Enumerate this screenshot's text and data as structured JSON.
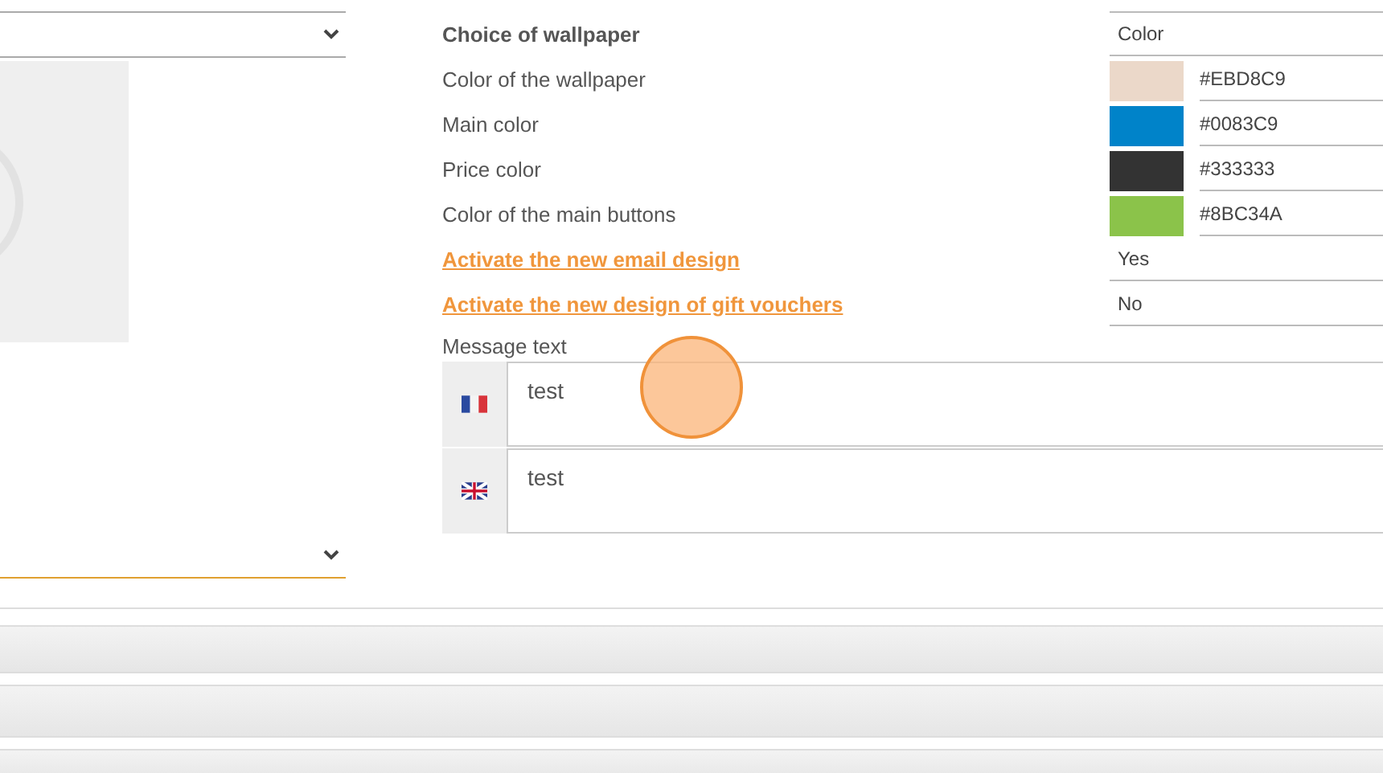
{
  "left_panel": {
    "selects": [
      {
        "focused": false
      },
      {
        "focused": true
      }
    ]
  },
  "settings": [
    {
      "label": "Choice of wallpaper",
      "kind": "heading",
      "value": "Color"
    },
    {
      "label": "Color of the wallpaper",
      "kind": "color",
      "value": "#EBD8C9",
      "color": "#ebd8c9"
    },
    {
      "label": "Main color",
      "kind": "color",
      "value": "#0083C9",
      "color": "#0083c9"
    },
    {
      "label": "Price color",
      "kind": "color",
      "value": "#333333",
      "color": "#333333"
    },
    {
      "label": "Color of the main buttons",
      "kind": "color",
      "value": "#8BC34A",
      "color": "#8bc34a"
    },
    {
      "label": "Activate the new email design",
      "kind": "link",
      "value": "Yes"
    },
    {
      "label": "Activate the new design of gift vouchers",
      "kind": "link",
      "value": "No"
    }
  ],
  "message": {
    "label": "Message text",
    "translations": [
      {
        "kind": "fr",
        "value": "test"
      },
      {
        "kind": "gb",
        "value": "test"
      }
    ]
  }
}
